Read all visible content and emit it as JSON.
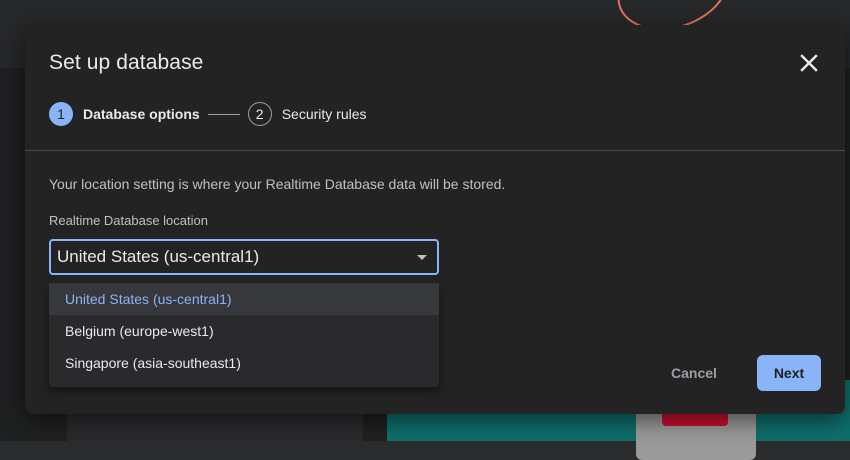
{
  "dialog": {
    "title": "Set up database",
    "close_icon": "close-icon"
  },
  "stepper": {
    "steps": [
      {
        "number": "1",
        "label": "Database options",
        "state": "active"
      },
      {
        "number": "2",
        "label": "Security rules",
        "state": "inactive"
      }
    ]
  },
  "content": {
    "description": "Your location setting is where your Realtime Database data will be stored.",
    "location_label": "Realtime Database location",
    "location_value": "United States (us-central1)",
    "dropdown_icon": "arrow-drop-down-icon",
    "options": [
      "United States (us-central1)",
      "Belgium (europe-west1)",
      "Singapore (asia-southeast1)"
    ]
  },
  "actions": {
    "cancel_label": "Cancel",
    "next_label": "Next"
  },
  "colors": {
    "accent": "#8ab4f8",
    "dialog_bg": "#232323",
    "text_primary": "#e8eaed",
    "text_secondary": "#bdc1c6"
  }
}
